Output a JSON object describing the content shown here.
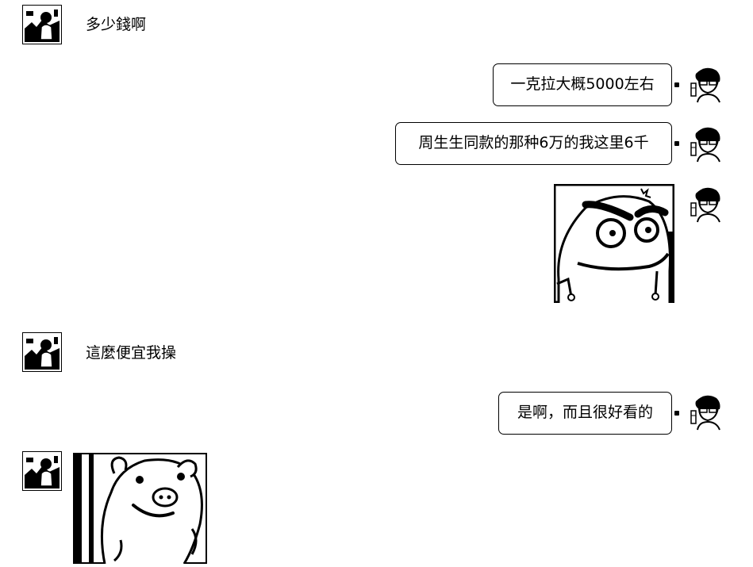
{
  "colors": {
    "background": "#ffffff",
    "ink": "#000000",
    "bubble_border": "#000000"
  },
  "messages": [
    {
      "sender": "contact",
      "kind": "text",
      "text": "多少錢啊"
    },
    {
      "sender": "me",
      "kind": "text",
      "text": "一克拉大概5000左右"
    },
    {
      "sender": "me",
      "kind": "text",
      "text": "周生生同款的那种6万的我这里6千"
    },
    {
      "sender": "me",
      "kind": "sticker",
      "icon": "smug-face-sticker"
    },
    {
      "sender": "contact",
      "kind": "text",
      "text": "這麼便宜我操"
    },
    {
      "sender": "me",
      "kind": "text",
      "text": "是啊，而且很好看的"
    },
    {
      "sender": "contact",
      "kind": "sticker",
      "icon": "pig-face-sticker"
    }
  ],
  "avatars": {
    "contact_icon": "contact-avatar-icon",
    "me_icon": "user-avatar-icon"
  }
}
